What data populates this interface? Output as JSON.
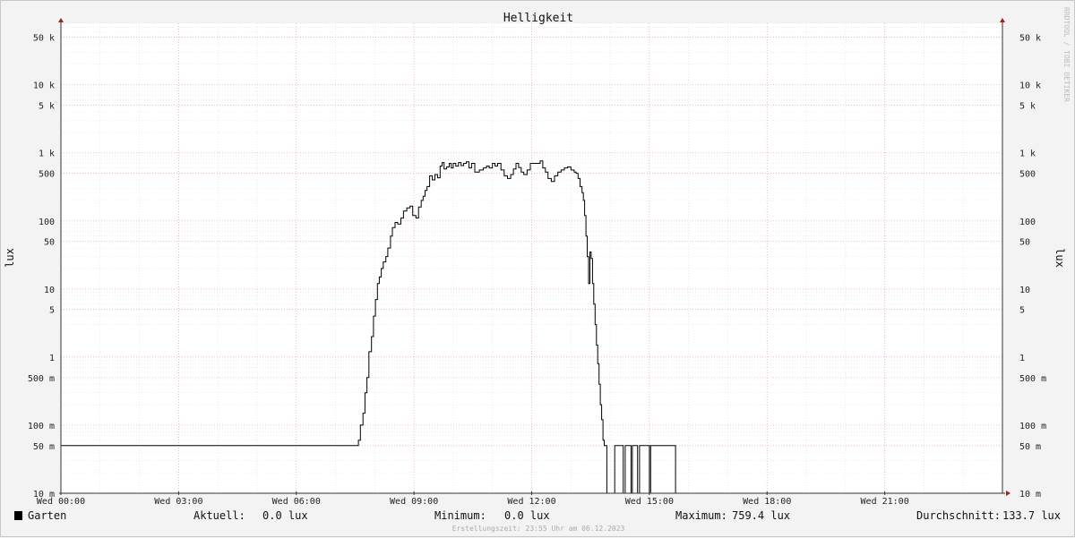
{
  "chart_data": {
    "type": "line",
    "title": "Helligkeit",
    "ylabel": "lux",
    "y_scale": "log",
    "ylim": [
      0.01,
      80000
    ],
    "xlim": [
      "Wed 00:00",
      "Wed 24:00"
    ],
    "x_ticks": [
      "Wed 00:00",
      "Wed 03:00",
      "Wed 06:00",
      "Wed 09:00",
      "Wed 12:00",
      "Wed 15:00",
      "Wed 18:00",
      "Wed 21:00"
    ],
    "y_ticks": [
      {
        "value": 0.01,
        "label": "10 m"
      },
      {
        "value": 0.05,
        "label": "50 m"
      },
      {
        "value": 0.1,
        "label": "100 m"
      },
      {
        "value": 0.5,
        "label": "500 m"
      },
      {
        "value": 1,
        "label": "1"
      },
      {
        "value": 5,
        "label": "5"
      },
      {
        "value": 10,
        "label": "10"
      },
      {
        "value": 50,
        "label": "50"
      },
      {
        "value": 100,
        "label": "100"
      },
      {
        "value": 500,
        "label": "500"
      },
      {
        "value": 1000,
        "label": "1 k"
      },
      {
        "value": 5000,
        "label": "5 k"
      },
      {
        "value": 10000,
        "label": "10 k"
      },
      {
        "value": 50000,
        "label": "50 k"
      }
    ],
    "grid": true,
    "series": [
      {
        "name": "Garten",
        "color": "#000000",
        "step": true,
        "points": [
          [
            "00:00",
            0.05
          ],
          [
            "07:35",
            0.06
          ],
          [
            "07:38",
            0.1
          ],
          [
            "07:42",
            0.15
          ],
          [
            "07:45",
            0.3
          ],
          [
            "07:48",
            0.5
          ],
          [
            "07:51",
            1.2
          ],
          [
            "07:55",
            2
          ],
          [
            "07:58",
            4
          ],
          [
            "08:01",
            7
          ],
          [
            "08:04",
            12
          ],
          [
            "08:07",
            15
          ],
          [
            "08:10",
            20
          ],
          [
            "08:13",
            25
          ],
          [
            "08:17",
            30
          ],
          [
            "08:20",
            40
          ],
          [
            "08:24",
            60
          ],
          [
            "08:27",
            80
          ],
          [
            "08:31",
            95
          ],
          [
            "08:35",
            90
          ],
          [
            "08:40",
            110
          ],
          [
            "08:44",
            140
          ],
          [
            "08:49",
            155
          ],
          [
            "08:54",
            165
          ],
          [
            "08:58",
            120
          ],
          [
            "09:03",
            110
          ],
          [
            "09:07",
            160
          ],
          [
            "09:11",
            200
          ],
          [
            "09:14",
            230
          ],
          [
            "09:17",
            280
          ],
          [
            "09:20",
            320
          ],
          [
            "09:24",
            460
          ],
          [
            "09:28",
            400
          ],
          [
            "09:32",
            480
          ],
          [
            "09:36",
            430
          ],
          [
            "09:40",
            640
          ],
          [
            "09:43",
            720
          ],
          [
            "09:46",
            580
          ],
          [
            "09:50",
            620
          ],
          [
            "09:54",
            700
          ],
          [
            "09:57",
            600
          ],
          [
            "10:00",
            700
          ],
          [
            "10:04",
            640
          ],
          [
            "10:08",
            720
          ],
          [
            "10:12",
            650
          ],
          [
            "10:16",
            700
          ],
          [
            "10:20",
            740
          ],
          [
            "10:24",
            600
          ],
          [
            "10:28",
            700
          ],
          [
            "10:33",
            520
          ],
          [
            "10:40",
            560
          ],
          [
            "10:46",
            600
          ],
          [
            "10:51",
            640
          ],
          [
            "10:55",
            600
          ],
          [
            "11:00",
            700
          ],
          [
            "11:04",
            640
          ],
          [
            "11:08",
            700
          ],
          [
            "11:13",
            560
          ],
          [
            "11:18",
            460
          ],
          [
            "11:23",
            420
          ],
          [
            "11:28",
            480
          ],
          [
            "11:32",
            580
          ],
          [
            "11:36",
            700
          ],
          [
            "11:40",
            610
          ],
          [
            "11:44",
            520
          ],
          [
            "11:48",
            480
          ],
          [
            "11:53",
            560
          ],
          [
            "11:58",
            700
          ],
          [
            "12:03",
            700
          ],
          [
            "12:08",
            700
          ],
          [
            "12:13",
            759.4
          ],
          [
            "12:17",
            600
          ],
          [
            "12:21",
            520
          ],
          [
            "12:25",
            420
          ],
          [
            "12:30",
            380
          ],
          [
            "12:35",
            460
          ],
          [
            "12:40",
            520
          ],
          [
            "12:45",
            560
          ],
          [
            "12:50",
            600
          ],
          [
            "12:55",
            620
          ],
          [
            "13:00",
            560
          ],
          [
            "13:05",
            520
          ],
          [
            "13:08",
            500
          ],
          [
            "13:11",
            420
          ],
          [
            "13:14",
            320
          ],
          [
            "13:17",
            260
          ],
          [
            "13:19",
            200
          ],
          [
            "13:21",
            120
          ],
          [
            "13:23",
            60
          ],
          [
            "13:25",
            30
          ],
          [
            "13:27",
            12
          ],
          [
            "13:29",
            35
          ],
          [
            "13:31",
            28
          ],
          [
            "13:33",
            12
          ],
          [
            "13:35",
            6
          ],
          [
            "13:37",
            3
          ],
          [
            "13:39",
            1.5
          ],
          [
            "13:41",
            0.8
          ],
          [
            "13:43",
            0.4
          ],
          [
            "13:45",
            0.2
          ],
          [
            "13:47",
            0.12
          ],
          [
            "13:49",
            0.06
          ],
          [
            "13:51",
            0.05
          ],
          [
            "13:55",
            0.01
          ],
          [
            "14:07",
            0.05
          ],
          [
            "14:20",
            0.01
          ],
          [
            "14:23",
            0.05
          ],
          [
            "14:32",
            0.01
          ],
          [
            "14:34",
            0.05
          ],
          [
            "14:42",
            0.01
          ],
          [
            "14:45",
            0.05
          ],
          [
            "15:00",
            0.01
          ],
          [
            "15:02",
            0.05
          ],
          [
            "15:40",
            0.01
          ],
          [
            "16:30",
            0.01
          ]
        ]
      }
    ],
    "legend": {
      "position": "bottom",
      "entry": "Garten",
      "stats": [
        {
          "label": "Aktuell:",
          "value": "0.0 lux"
        },
        {
          "label": "Minimum:",
          "value": "0.0 lux"
        },
        {
          "label": "Maximum:",
          "value": "759.4 lux"
        },
        {
          "label": "Durchschnitt:",
          "value": "133.7 lux"
        }
      ]
    },
    "footer": "Erstellungszeit: 23:55 Uhr am 06.12.2023",
    "watermark": "RRDTOOL / TOBI OETIKER"
  }
}
